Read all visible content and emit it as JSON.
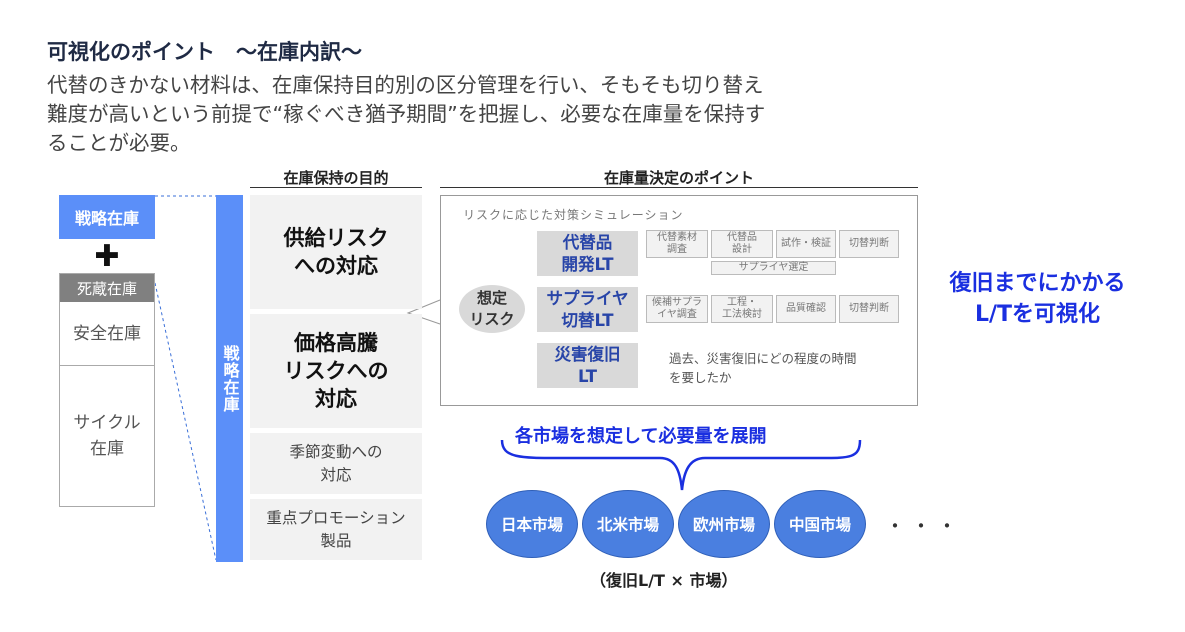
{
  "heading": "可視化のポイント　～在庫内訳～",
  "paragraph": {
    "line1": "代替のきかない材料は、在庫保持目的別の区分管理を行い、そもそも切り替え",
    "line2": "難度が高いという前提で“稼ぐべき猶予期間”を把握し、必要な在庫量を保持す",
    "line3": "ることが必要。"
  },
  "left": {
    "strategic": "戦略在庫",
    "plus": "✚",
    "dead": "死蔵在庫",
    "safety": "安全在庫",
    "cycle_line1": "サイクル",
    "cycle_line2": "在庫"
  },
  "vbar": "戦略在庫",
  "purpose_header": "在庫保持の目的",
  "purposes": {
    "p1_line1": "供給リスク",
    "p1_line2": "への対応",
    "p2_line1": "価格高騰",
    "p2_line2": "リスクへの",
    "p2_line3": "対応",
    "p3_line1": "季節変動への",
    "p3_line2": "対応",
    "p4_line1": "重点プロモーション",
    "p4_line2": "製品"
  },
  "points_header": "在庫量決定のポイント",
  "panel": {
    "title": "リスクに応じた対策シミュレーション",
    "oval_line1": "想定",
    "oval_line2": "リスク",
    "cat1_line1": "代替品",
    "cat1_line2": "開発LT",
    "cat2_line1": "サプライヤ",
    "cat2_line2": "切替LT",
    "cat3_line1": "災害復旧",
    "cat3_line2": "LT",
    "row1": {
      "s1a": "代替素材",
      "s1b": "調査",
      "s2a": "代替品",
      "s2b": "設計",
      "s3": "試作・検証",
      "s4": "切替判断",
      "sub": "サプライヤ選定"
    },
    "row2": {
      "s1a": "候補サプラ",
      "s1b": "イヤ調査",
      "s2a": "工程・",
      "s2b": "工法検討",
      "s3": "品質確認",
      "s4": "切替判断"
    },
    "note_line1": "過去、災害復旧にどの程度の時間",
    "note_line2": "を要したか"
  },
  "right": {
    "line1": "復旧までにかかる",
    "line2": "L/Tを可視化"
  },
  "deploy": "各市場を想定して必要量を展開",
  "markets": [
    "日本市場",
    "北米市場",
    "欧州市場",
    "中国市場"
  ],
  "more": "・・・",
  "formula": "（復旧L/T × 市場）",
  "colors": {
    "accent_blue": "#5b8ff9",
    "text_blue": "#1a2fe0",
    "market_blue": "#4a7fe0"
  }
}
